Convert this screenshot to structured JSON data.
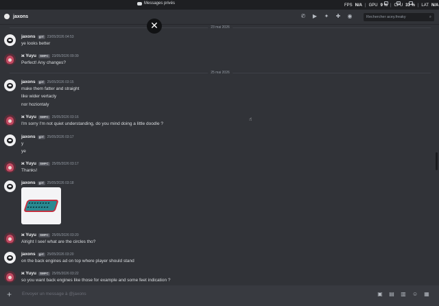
{
  "window": {
    "title": "Messages privés"
  },
  "perf": {
    "fps_label": "FPS",
    "fps_value": "N/A",
    "gpu_label": "GPU",
    "gpu_value": "9 %",
    "cpu_label": "CPU",
    "cpu_value": "33 %",
    "lat_label": "LAT",
    "lat_value": "N/A"
  },
  "header": {
    "username": "jaxons",
    "search_placeholder": "Rechercher acey.freaky"
  },
  "dividers": [
    {
      "date": "23 mai 2026"
    },
    {
      "date": "25 mai 2026"
    }
  ],
  "messages": [
    {
      "author": "jaxons",
      "tag": "girl",
      "time": "23/05/2026 04:53",
      "lines": [
        "ye looks better"
      ]
    },
    {
      "author": "ж Yuyu",
      "tag": "SMFC",
      "time": "23/05/2026 09:39",
      "lines": [
        "Perfect! Any changes?"
      ]
    },
    {
      "author": "jaxons",
      "tag": "girl",
      "time": "25/05/2026 03:15",
      "lines": [
        "make them fatter  and straight",
        "like wider vertacly",
        "nor hoziontaly"
      ]
    },
    {
      "author": "ж Yuyu",
      "tag": "SMFC",
      "time": "25/05/2026 03:16",
      "lines": [
        "I'm sorry I'm not quiet understanding, do you mind doing a little doodle ?"
      ]
    },
    {
      "author": "jaxons",
      "tag": "girl",
      "time": "25/05/2026 03:17",
      "lines": [
        "y",
        "ye"
      ]
    },
    {
      "author": "ж Yuyu",
      "tag": "SMFC",
      "time": "25/05/2026 03:17",
      "lines": [
        "Thanks!"
      ]
    },
    {
      "author": "jaxons",
      "tag": "girl",
      "time": "25/05/2026 03:18",
      "lines": []
    },
    {
      "author": "ж Yuyu",
      "tag": "SMFC",
      "time": "25/05/2026 03:20",
      "lines": [
        "Alright I see! what are the circles tho?"
      ]
    },
    {
      "author": "jaxons",
      "tag": "girl",
      "time": "25/05/2026 03:20",
      "lines": [
        "on the back engines ad on top where player should stand"
      ]
    },
    {
      "author": "ж Yuyu",
      "tag": "SMFC",
      "time": "25/05/2026 03:22",
      "lines": [
        "so you want back engines like those for example and some feet indication ?"
      ]
    }
  ],
  "composer": {
    "placeholder": "Envoyer un message à @jaxons"
  },
  "icons": {
    "header": [
      "phone-icon",
      "video-icon",
      "pin-icon",
      "add-member-icon",
      "profile-icon"
    ],
    "composer": [
      "gift-icon",
      "gif-icon",
      "sticker-icon",
      "emoji-icon",
      "apps-icon"
    ]
  }
}
